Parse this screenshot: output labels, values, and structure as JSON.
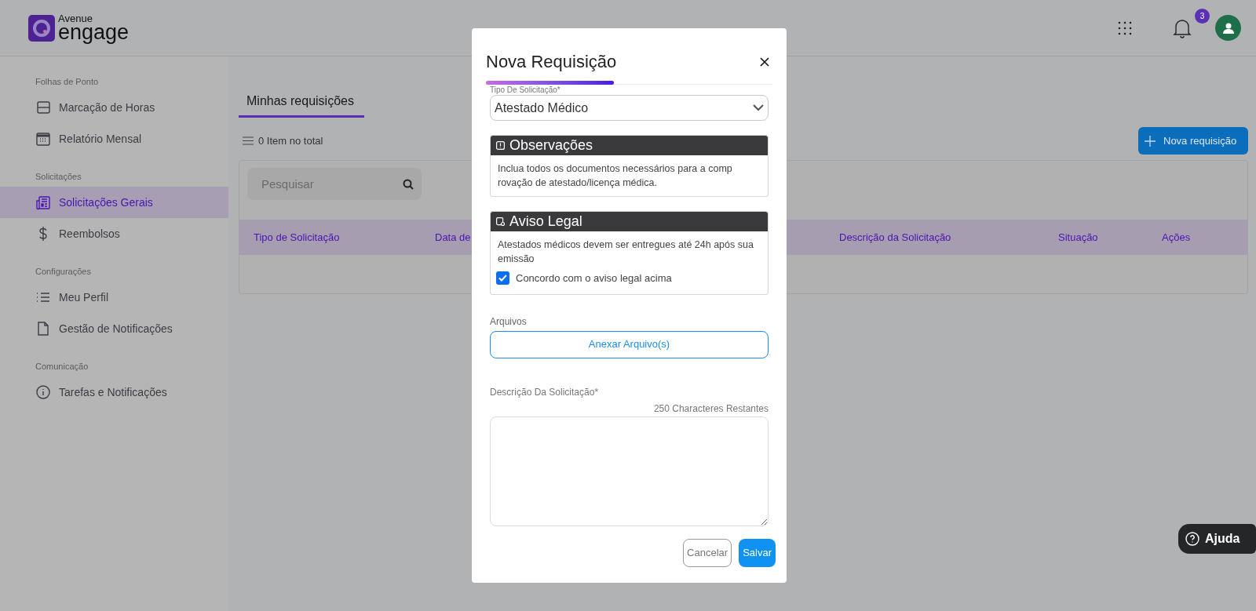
{
  "logo": {
    "line1": "Avenue",
    "line2": "engage"
  },
  "header": {
    "notification_count": "3"
  },
  "sidebar": {
    "sections": [
      {
        "title": "Folhas de Ponto",
        "items": [
          {
            "label": "Marcação de Horas",
            "kind": "timesheet",
            "selected": false
          },
          {
            "label": "Relatório Mensal",
            "kind": "calendar",
            "selected": false
          }
        ]
      },
      {
        "title": "Solicitações",
        "items": [
          {
            "label": "Solicitações Gerais",
            "kind": "newspaper",
            "selected": true
          },
          {
            "label": "Reembolsos",
            "kind": "dollar",
            "selected": false
          }
        ]
      },
      {
        "title": "Configurações",
        "items": [
          {
            "label": "Meu Perfil",
            "kind": "list",
            "selected": false
          },
          {
            "label": "Gestão de Notificações",
            "kind": "file",
            "selected": false
          }
        ]
      },
      {
        "title": "Comunicação",
        "items": [
          {
            "label": "Tarefas e Notificações",
            "kind": "info",
            "selected": false
          }
        ]
      }
    ]
  },
  "main": {
    "tabs": [
      {
        "label": "Minhas requisições",
        "selected": true
      }
    ],
    "item_count": "0 Item no total",
    "new_button": "Nova requisição",
    "search": {
      "placeholder": "Pesquisar"
    },
    "table": {
      "columns": [
        "Tipo de Solicitação",
        "Data de",
        "Descrição da Solicitação",
        "Situação",
        "Ações"
      ]
    }
  },
  "modal": {
    "title": "Nova Requisição",
    "type_label": "Tipo De Solicitação*",
    "type_value": "Atestado Médico",
    "notes": {
      "title": "Observações",
      "text": "Inclua todos os documentos necessários para a comp rovação de atestado/licença médica."
    },
    "legal": {
      "title": "Aviso Legal",
      "text": "Atestados médicos devem ser entregues até 24h após sua emissão",
      "agree_label": "Concordo com o aviso legal acima",
      "checked": true
    },
    "files_label": "Arquivos",
    "attach_button": "Anexar Arquivo(s)",
    "description_label": "Descrição Da Solicitação*",
    "counter": "250 Characteres Restantes",
    "buttons": {
      "cancel": "Cancelar",
      "save": "Salvar"
    }
  },
  "help_button": "Ajuda"
}
